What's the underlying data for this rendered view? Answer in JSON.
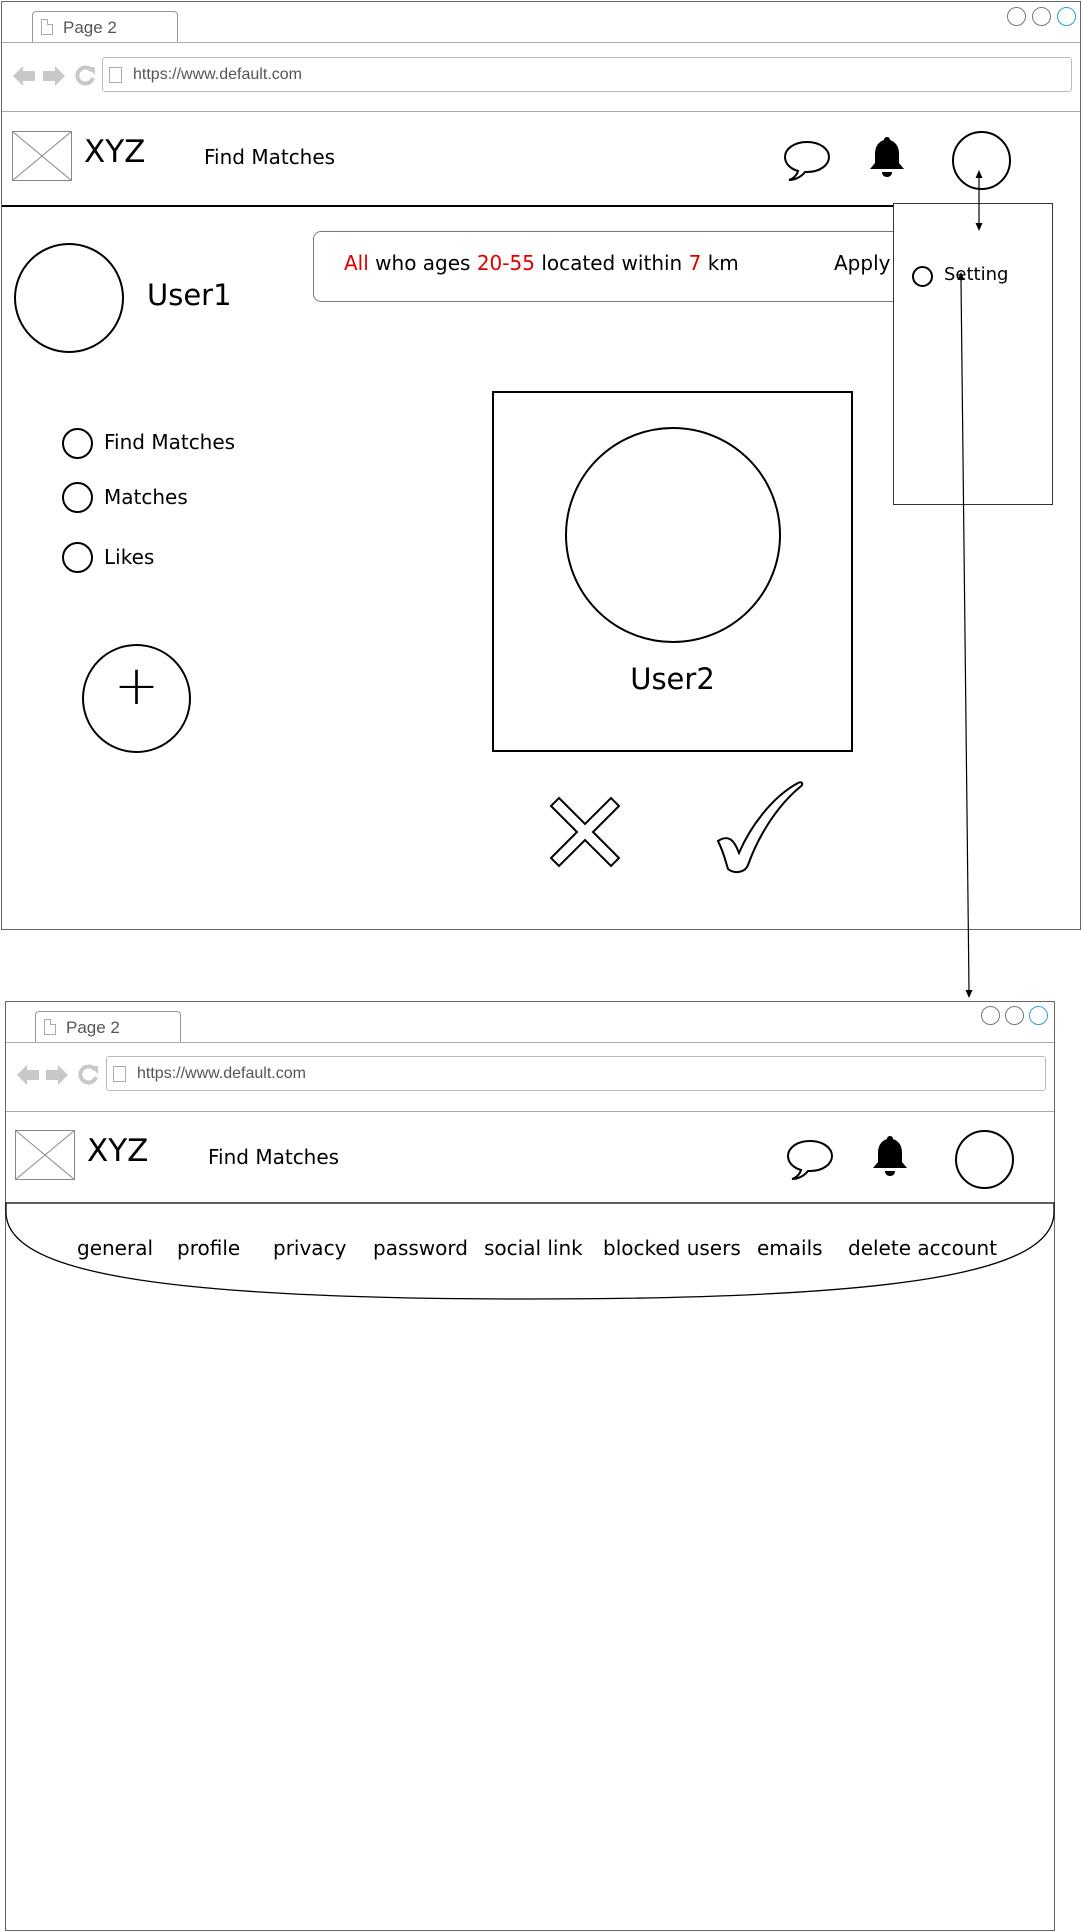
{
  "window1": {
    "tab_label": "Page 2",
    "url": "https://www.default.com",
    "brand": "XYZ",
    "nav_link": "Find Matches",
    "user_name": "User1",
    "filter": {
      "who": "All",
      "text1": "who ages",
      "age_range": "20-55",
      "text2": "located within",
      "distance": "7",
      "unit": "km",
      "apply_label": "Apply"
    },
    "dropdown": {
      "item_label": "Setting"
    },
    "side_menu": [
      {
        "label": "Find Matches"
      },
      {
        "label": "Matches"
      },
      {
        "label": "Likes"
      }
    ],
    "add_button_symbol": "+",
    "card_user": "User2"
  },
  "window2": {
    "tab_label": "Page 2",
    "url": "https://www.default.com",
    "brand": "XYZ",
    "nav_link": "Find Matches",
    "settings_tabs": [
      {
        "label": "general"
      },
      {
        "label": "profile"
      },
      {
        "label": "privacy"
      },
      {
        "label": "password"
      },
      {
        "label": "social link"
      },
      {
        "label": "blocked users"
      },
      {
        "label": "emails"
      },
      {
        "label": "delete account"
      }
    ]
  },
  "colors": {
    "highlight": "#e00000",
    "active_window_control": "#2a9fd6"
  },
  "icons": [
    "chat-bubble-icon",
    "bell-icon",
    "back-arrow-icon",
    "forward-arrow-icon",
    "reload-icon",
    "reject-x-icon",
    "accept-check-icon",
    "plus-icon"
  ]
}
